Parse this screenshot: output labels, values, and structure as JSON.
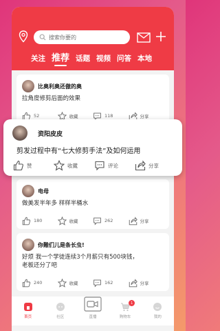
{
  "colors": {
    "brand": "#ef3b45",
    "background": "#f3f3f3"
  },
  "search": {
    "placeholder": "搜索你要的"
  },
  "tabs": [
    {
      "label": "关注"
    },
    {
      "label": "推荐",
      "active": true
    },
    {
      "label": "话题"
    },
    {
      "label": "视频"
    },
    {
      "label": "问答"
    },
    {
      "label": "本地"
    }
  ],
  "posts": [
    {
      "user": "比奥利奥还傲的奥",
      "text": "拉角度修剪后面的效果",
      "likes": "52",
      "favorite": "收藏",
      "comments": "118",
      "share": "分享"
    },
    {
      "user": "资阳皮皮",
      "text": "剪发过程中有“七大修剪手法”及如何运用",
      "likes": "赞",
      "favorite": "收藏",
      "comments": "评论",
      "share": "分享"
    },
    {
      "user": "电母",
      "text": "做美发半年多 样样半桶水",
      "likes": "180",
      "favorite": "收藏",
      "comments": "262",
      "share": "分享"
    },
    {
      "user": "你難们儿是条长虫!",
      "text_line1": "好烦 我一个学徒连续3个月薪只有500块钱，",
      "text_line2": "老板还分了吧",
      "likes": "240",
      "favorite": "收藏",
      "comments": "162",
      "share": "分享"
    }
  ],
  "nav": [
    {
      "label": "首页",
      "icon": "home-icon",
      "active": true
    },
    {
      "label": "社区",
      "icon": "community-icon"
    },
    {
      "label": "直播",
      "icon": "live-camera-icon"
    },
    {
      "label": "购物车",
      "icon": "cart-icon",
      "badge": "1"
    },
    {
      "label": "我的",
      "icon": "profile-icon"
    }
  ]
}
